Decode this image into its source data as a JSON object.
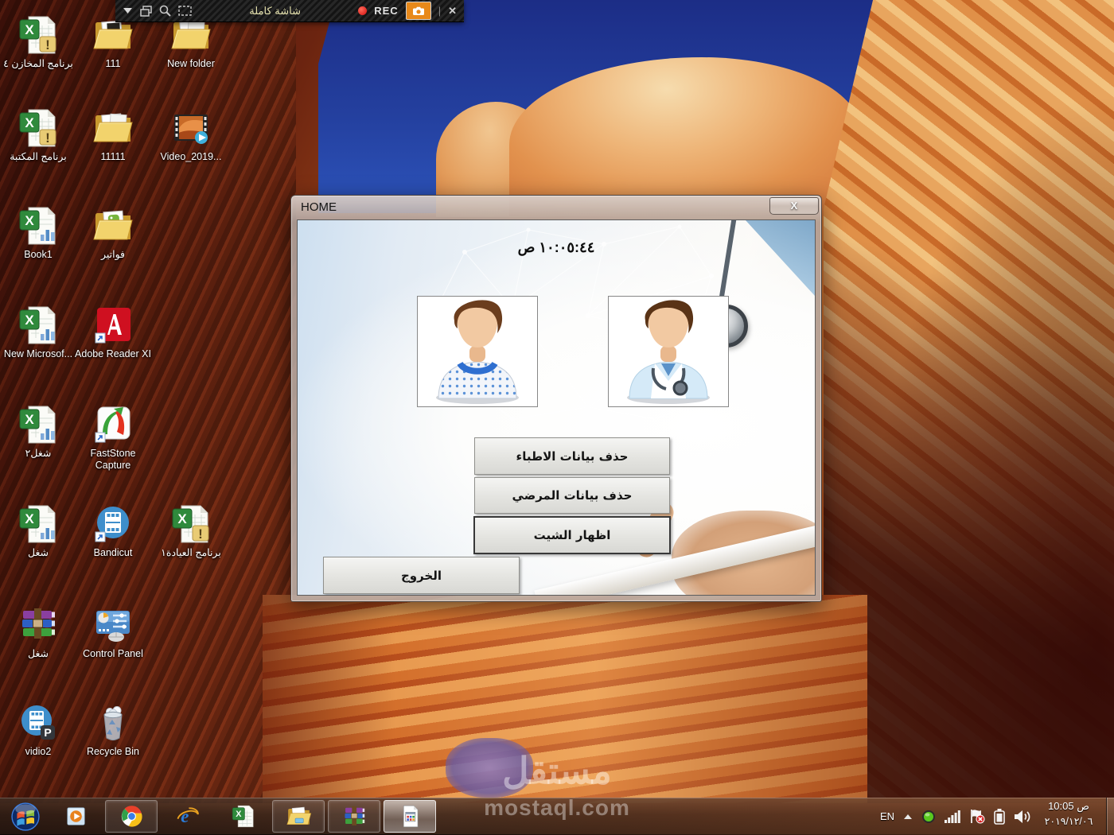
{
  "recorder_bar": {
    "title": "شاشة كاملة",
    "rec_label": "REC",
    "icons": [
      "dropdown-arrow-icon",
      "windows-copy-icon",
      "magnifier-icon",
      "region-select-icon",
      "record-dot-icon",
      "camera-icon",
      "close-icon"
    ],
    "close_label": "✕",
    "separator": "|"
  },
  "desktop": {
    "icons": [
      {
        "label": "برنامج المخازن ٤",
        "kind": "excel-warn"
      },
      {
        "label": "111",
        "kind": "folder-dark"
      },
      {
        "label": "New folder",
        "kind": "folder"
      },
      {
        "label": "برنامج المكتبة",
        "kind": "excel-warn"
      },
      {
        "label": "11111",
        "kind": "folder"
      },
      {
        "label": "Video_2019...",
        "kind": "video"
      },
      {
        "label": "Book1",
        "kind": "excel-chart"
      },
      {
        "label": "فواتير",
        "kind": "folder-app"
      },
      {
        "label": "New Microsof...",
        "kind": "excel-chart"
      },
      {
        "label": "Adobe Reader XI",
        "kind": "adobe"
      },
      {
        "label": "شغل٢",
        "kind": "excel-chart"
      },
      {
        "label": "FastStone Capture",
        "kind": "faststone"
      },
      {
        "label": "شغل",
        "kind": "excel-chart"
      },
      {
        "label": "Bandicut",
        "kind": "bandicut"
      },
      {
        "label": "برنامج العيادة١",
        "kind": "excel-warn"
      },
      {
        "label": "شغل",
        "kind": "winrar"
      },
      {
        "label": "Control Panel",
        "kind": "control-panel"
      },
      {
        "label": "vidio2",
        "kind": "vidio2"
      },
      {
        "label": "Recycle Bin",
        "kind": "recycle-bin"
      }
    ]
  },
  "dialog": {
    "title": "HOME",
    "close_label": "X",
    "clock": "١٠:٠٥:٤٤ ص",
    "buttons": [
      {
        "label": "حذف بيانات الاطباء"
      },
      {
        "label": "حذف بيانات المرضي"
      },
      {
        "label": "اظهار الشيت"
      },
      {
        "label": "الخروج"
      }
    ],
    "images": [
      "patient-avatar",
      "doctor-avatar"
    ]
  },
  "taskbar": {
    "items": [
      {
        "name": "windows-media-player",
        "state": "pinned"
      },
      {
        "name": "chrome",
        "state": "running"
      },
      {
        "name": "internet-explorer",
        "state": "pinned"
      },
      {
        "name": "excel",
        "state": "pinned"
      },
      {
        "name": "windows-explorer",
        "state": "running"
      },
      {
        "name": "winrar",
        "state": "running"
      },
      {
        "name": "vb-form-app",
        "state": "active"
      }
    ],
    "tray": {
      "language": "EN",
      "icons": [
        "show-hidden-arrow-icon",
        "green-status-icon",
        "signal-bars-icon",
        "action-center-flag-icon",
        "battery-icon",
        "volume-icon"
      ],
      "time": "10:05 ص",
      "date": "٢٠١٩/١٢/٠٦"
    }
  },
  "watermark": {
    "arabic": "مستقل",
    "latin": "mostaql.com"
  },
  "colors": {
    "sky": "#24409f",
    "rock_dark": "#57180c",
    "rock_orange": "#d9793a",
    "rec_camera": "#e8891a",
    "rec_title": "#e6e2ae",
    "button_face": "#e4e4e0"
  }
}
